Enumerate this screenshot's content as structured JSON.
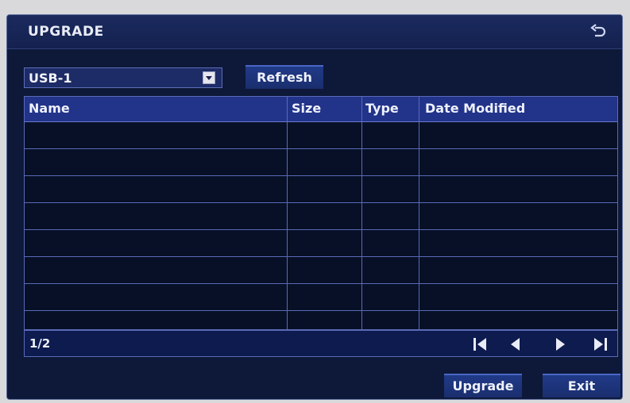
{
  "window": {
    "title": "UPGRADE"
  },
  "device_select": {
    "value": "USB-1"
  },
  "toolbar": {
    "refresh_label": "Refresh"
  },
  "table": {
    "columns": [
      "Name",
      "Size",
      "Type",
      "Date Modified"
    ],
    "rows": [
      [
        "",
        "",
        "",
        ""
      ],
      [
        "",
        "",
        "",
        ""
      ],
      [
        "",
        "",
        "",
        ""
      ],
      [
        "",
        "",
        "",
        ""
      ],
      [
        "",
        "",
        "",
        ""
      ],
      [
        "",
        "",
        "",
        ""
      ],
      [
        "",
        "",
        "",
        ""
      ],
      [
        "",
        "",
        "",
        ""
      ]
    ]
  },
  "pager": {
    "page": "1/2"
  },
  "actions": {
    "upgrade_label": "Upgrade",
    "exit_label": "Exit"
  },
  "icons": {
    "back": "back-arrow-icon",
    "first": "first-page-icon",
    "prev": "previous-page-icon",
    "next": "next-page-icon",
    "last": "last-page-icon"
  },
  "colors": {
    "panel": "#0e1838",
    "accent": "#22338a",
    "border": "#5a6ab8",
    "text": "#eef1fb"
  }
}
